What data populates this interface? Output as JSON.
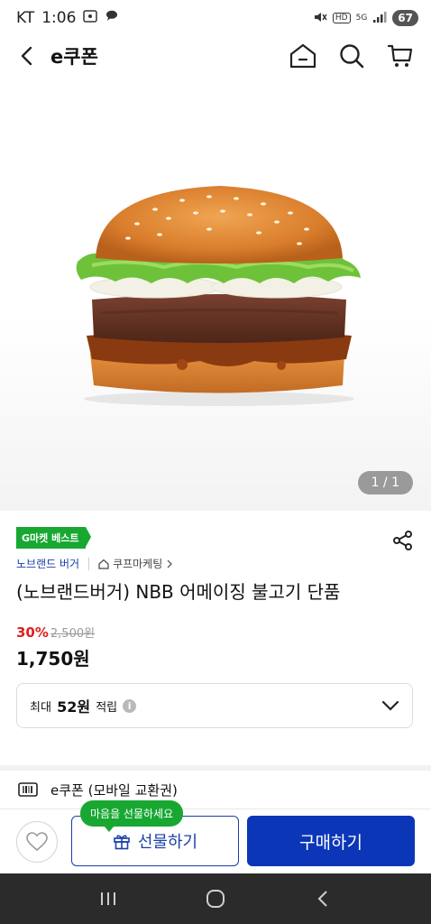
{
  "status_bar": {
    "carrier": "KT",
    "time": "1:06",
    "network": "5G",
    "hd": "HD",
    "battery": "67"
  },
  "header": {
    "title": "e쿠폰",
    "icons": [
      "back-arrow-icon",
      "home-icon",
      "search-icon",
      "cart-icon"
    ]
  },
  "hero": {
    "page_indicator": "1 / 1",
    "image": "burger-image"
  },
  "product": {
    "badge": "G마켓 베스트",
    "brand": "노브랜드 버거",
    "shop": "쿠프마케팅",
    "title": "(노브랜드버거) NBB 어메이징 불고기 단품",
    "discount": "30%",
    "original_price": "2,500원",
    "final_price": "1,750원",
    "points_prefix": "최대",
    "points_value": "52원",
    "points_suffix": "적립"
  },
  "coupon": {
    "label": "e쿠폰 (모바일 교환권)"
  },
  "actions": {
    "tooltip": "마음을 선물하세요",
    "gift_label": "선물하기",
    "buy_label": "구매하기"
  },
  "colors": {
    "accent_blue": "#0b36b8",
    "badge_green": "#18a832",
    "discount_red": "#e02020"
  }
}
